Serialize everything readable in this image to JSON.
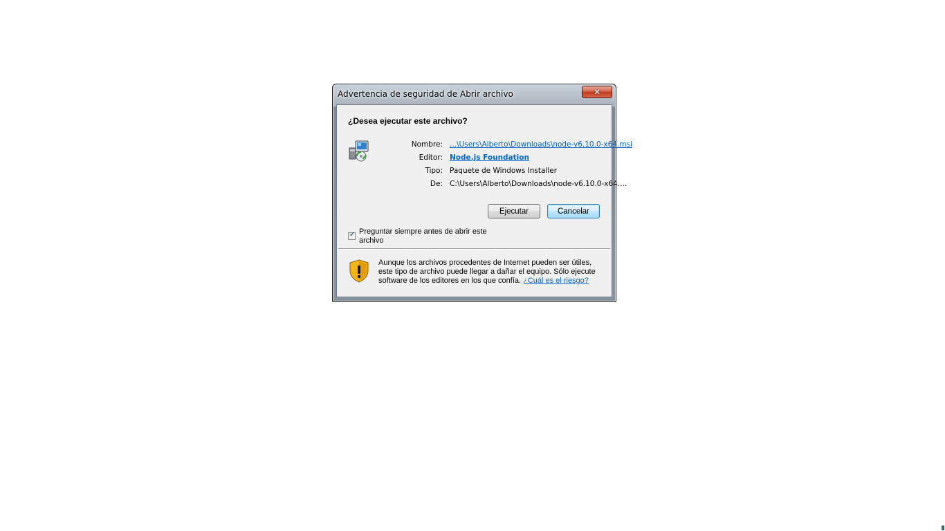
{
  "dialog": {
    "title": "Advertencia de seguridad de Abrir archivo",
    "close_label": "✕",
    "question": "¿Desea ejecutar este archivo?",
    "icon": "windows-installer-icon",
    "fields": {
      "name_label": "Nombre:",
      "name_value": "...\\Users\\Alberto\\Downloads\\node-v6.10.0-x64.msi",
      "publisher_label": "Editor:",
      "publisher_value": "Node.js Foundation",
      "type_label": "Tipo:",
      "type_value": "Paquete de Windows Installer",
      "from_label": "De:",
      "from_value": "C:\\Users\\Alberto\\Downloads\\node-v6.10.0-x64...."
    },
    "buttons": {
      "run": "Ejecutar",
      "cancel": "Cancelar"
    },
    "checkbox": {
      "label": "Preguntar siempre antes de abrir este archivo",
      "checked": true
    },
    "warning": {
      "icon": "security-shield-warning-icon",
      "text": "Aunque los archivos procedentes de Internet pueden ser útiles, este tipo de archivo puede llegar a dañar el equipo. Sólo ejecute software de los editores en los que confía.",
      "link": "¿Cuál es el riesgo?"
    }
  },
  "colors": {
    "link": "#0066cc",
    "dialog_bg": "#f0f0f0",
    "close_button": "#c03b1f",
    "shield_yellow": "#f2b51c"
  }
}
